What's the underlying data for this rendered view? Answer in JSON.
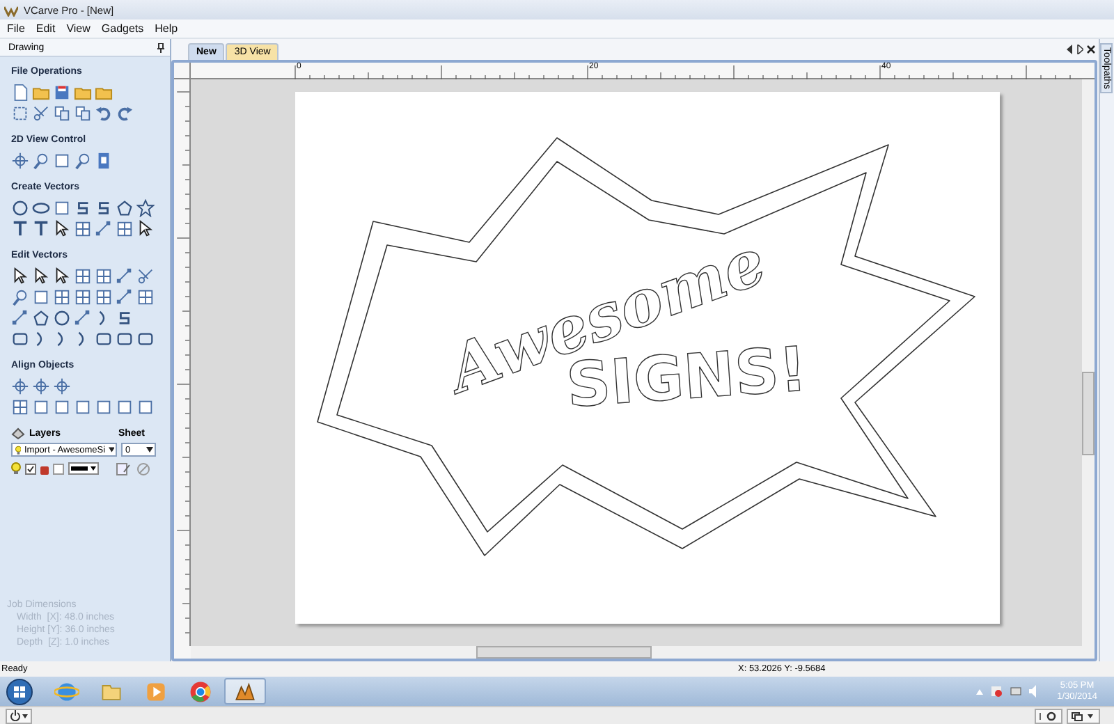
{
  "window": {
    "title": "VCarve Pro - [New]"
  },
  "menu": [
    {
      "label": "File"
    },
    {
      "label": "Edit"
    },
    {
      "label": "View"
    },
    {
      "label": "Gadgets"
    },
    {
      "label": "Help"
    }
  ],
  "sidebar": {
    "title": "Drawing",
    "sections": [
      {
        "title": "File Operations"
      },
      {
        "title": "2D View Control"
      },
      {
        "title": "Create Vectors"
      },
      {
        "title": "Edit Vectors"
      },
      {
        "title": "Align Objects"
      }
    ],
    "layers": {
      "label": "Layers",
      "sheet_label": "Sheet",
      "layer_value": "Import - AwesomeSi",
      "sheet_value": "0"
    },
    "job_dimensions": {
      "title": "Job Dimensions",
      "lines": [
        "Width  [X]: 48.0 inches",
        "Height [Y]: 36.0 inches",
        "Depth  [Z]: 1.0 inches"
      ]
    }
  },
  "tabs": [
    {
      "label": "New",
      "selected": true
    },
    {
      "label": "3D View",
      "selected": false
    }
  ],
  "side_tab": {
    "label": "Toolpaths"
  },
  "ruler": {
    "labels": [
      "0",
      "20",
      "40"
    ]
  },
  "design": {
    "texts": [
      "Awesome",
      "SIGNS!"
    ]
  },
  "status_bar": {
    "message": "Ready",
    "coordinates": "X: 53.2026 Y: -9.5684"
  },
  "taskbar": {
    "apps": [
      {
        "selected": false
      },
      {
        "selected": false
      },
      {
        "selected": false
      },
      {
        "selected": false
      },
      {
        "selected": true
      }
    ],
    "time": "5:05 PM",
    "date": "1/30/2014"
  }
}
